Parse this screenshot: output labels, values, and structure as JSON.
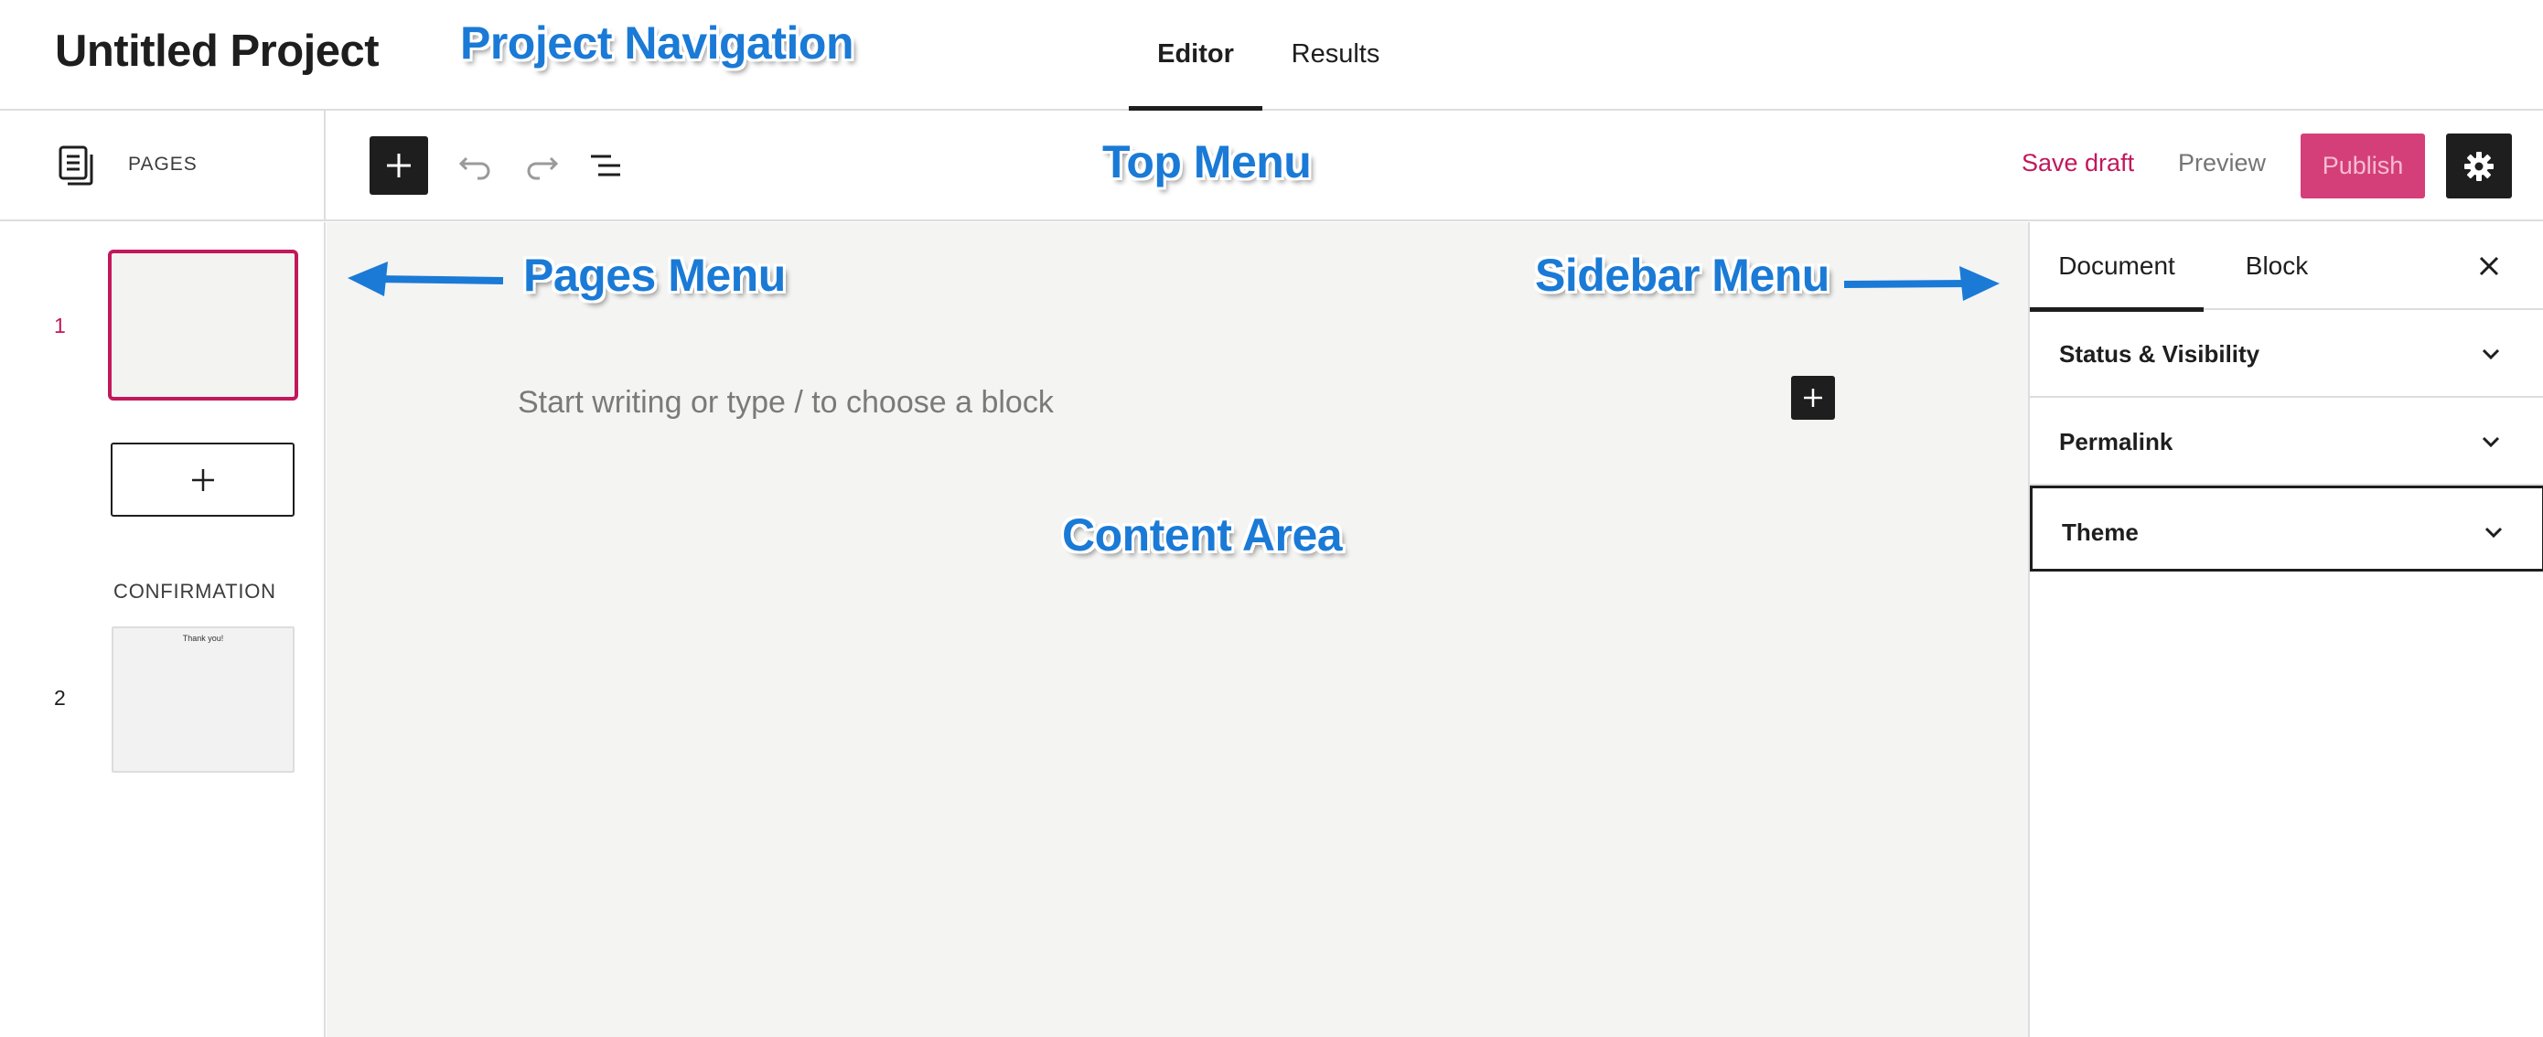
{
  "header": {
    "project_title": "Untitled Project",
    "tabs": [
      {
        "label": "Editor",
        "active": true
      },
      {
        "label": "Results",
        "active": false
      }
    ]
  },
  "pages_header": {
    "label": "PAGES",
    "icon": "pages-icon"
  },
  "toolbar": {
    "add_icon": "plus-icon",
    "undo_icon": "undo-icon",
    "redo_icon": "redo-icon",
    "list_view_icon": "list-view-icon",
    "save_draft_label": "Save draft",
    "preview_label": "Preview",
    "publish_label": "Publish",
    "settings_icon": "gear-icon"
  },
  "pages": {
    "items": [
      {
        "number": "1"
      },
      {
        "number": "2",
        "section_label": "CONFIRMATION",
        "thumb_text": "Thank you!"
      }
    ],
    "add_page_icon": "plus-icon"
  },
  "content": {
    "placeholder": "Start writing or type / to choose a block"
  },
  "sidebar": {
    "tabs": [
      {
        "label": "Document",
        "active": true
      },
      {
        "label": "Block",
        "active": false
      }
    ],
    "close_icon": "close-icon",
    "panels": [
      {
        "label": "Status & Visibility"
      },
      {
        "label": "Permalink"
      },
      {
        "label": "Theme"
      }
    ]
  },
  "annotations": {
    "project_navigation": "Project Navigation",
    "top_menu": "Top Menu",
    "pages_menu": "Pages Menu",
    "sidebar_menu": "Sidebar Menu",
    "content_area": "Content Area"
  },
  "colors": {
    "accent": "#c2185b",
    "publish_bg": "#d12b6b",
    "annotation": "#1a7ad6",
    "dark": "#1e1e1e",
    "content_bg": "#f4f4f3"
  }
}
